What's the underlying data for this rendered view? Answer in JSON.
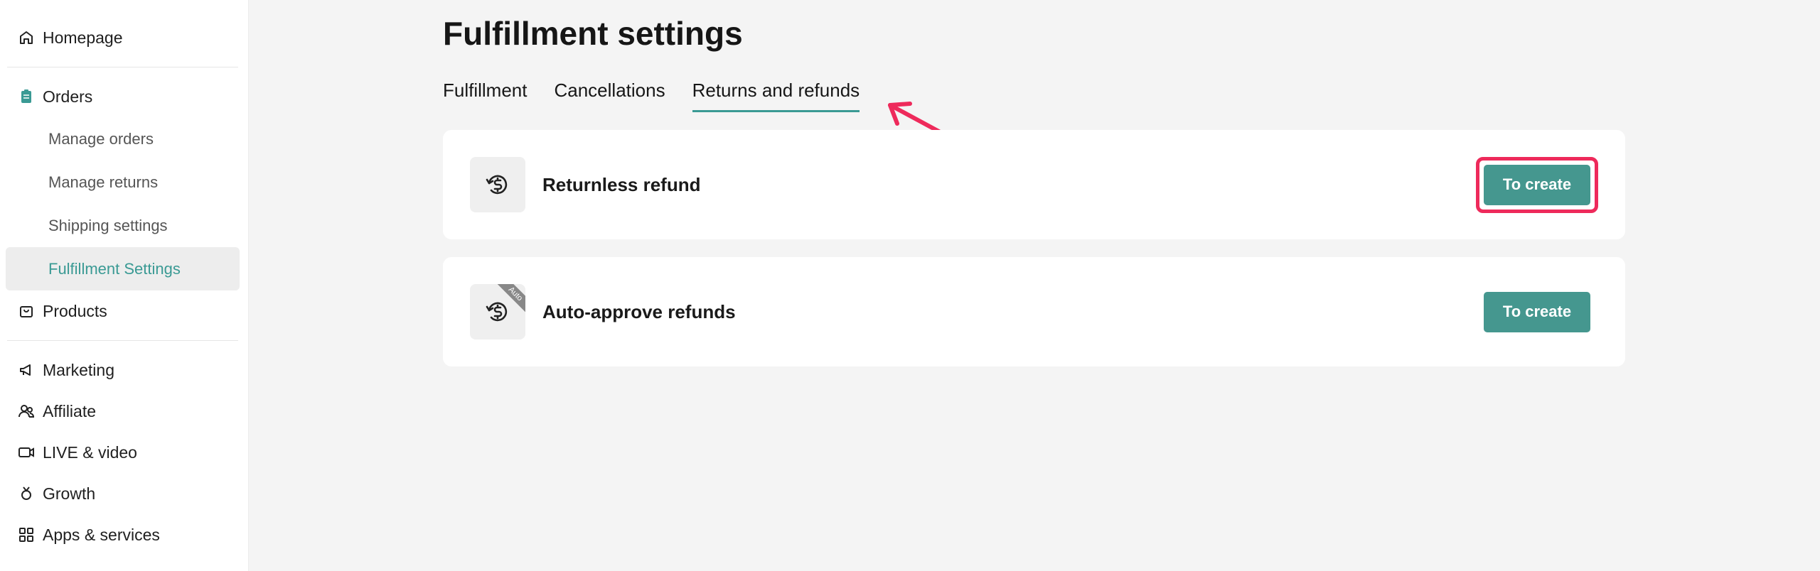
{
  "sidebar": {
    "items": [
      {
        "label": "Homepage",
        "icon": "home-icon"
      },
      {
        "label": "Orders",
        "icon": "clipboard-icon"
      },
      {
        "label": "Manage orders"
      },
      {
        "label": "Manage returns"
      },
      {
        "label": "Shipping settings"
      },
      {
        "label": "Fulfillment Settings"
      },
      {
        "label": "Products",
        "icon": "bag-icon"
      },
      {
        "label": "Marketing",
        "icon": "megaphone-icon"
      },
      {
        "label": "Affiliate",
        "icon": "users-icon"
      },
      {
        "label": "LIVE & video",
        "icon": "video-icon"
      },
      {
        "label": "Growth",
        "icon": "medal-icon"
      },
      {
        "label": "Apps & services",
        "icon": "grid-icon"
      }
    ],
    "active_item": "Fulfillment Settings"
  },
  "page": {
    "title": "Fulfillment settings",
    "tabs": [
      {
        "label": "Fulfillment"
      },
      {
        "label": "Cancellations"
      },
      {
        "label": "Returns and refunds"
      }
    ],
    "active_tab": "Returns and refunds"
  },
  "cards": [
    {
      "title": "Returnless refund",
      "button": "To create",
      "icon": "refund-dollar-icon"
    },
    {
      "title": "Auto-approve refunds",
      "button": "To create",
      "icon": "refund-dollar-icon",
      "badge": "Auto"
    }
  ],
  "colors": {
    "accent": "#45978f",
    "highlight": "#ee2a5b",
    "active_text": "#3a9a94"
  }
}
